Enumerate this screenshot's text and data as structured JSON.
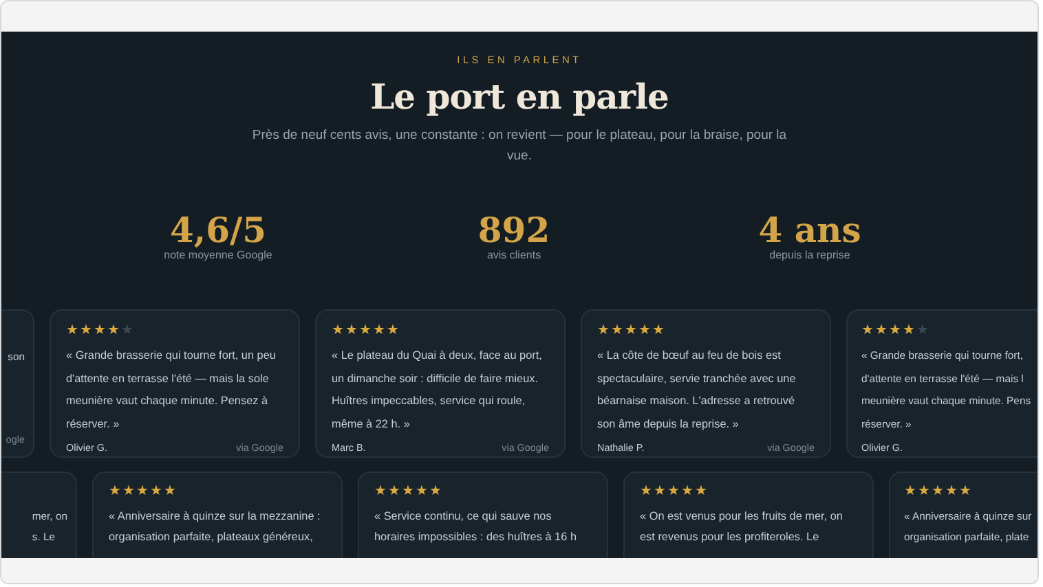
{
  "eyebrow": "ILS EN PARLENT",
  "title": "Le port en parle",
  "subtitle": "Près de neuf cents avis, une constante : on revient — pour le plateau, pour la braise, pour la vue.",
  "stats": [
    {
      "value": "4,6/5",
      "label": "note moyenne Google"
    },
    {
      "value": "892",
      "label": "avis clients"
    },
    {
      "value": "4 ans",
      "label": "depuis la reprise"
    }
  ],
  "review_rows": [
    {
      "cards": [
        {
          "kind": "partial-left",
          "lines": [
            "son"
          ],
          "source": "ogle"
        },
        {
          "kind": "full",
          "stars": 4,
          "text": "« Grande brasserie qui tourne fort, un peu d'attente en terrasse l'été — mais la sole meunière vaut chaque minute. Pensez à réserver. »",
          "author": "Olivier G.",
          "source": "via Google"
        },
        {
          "kind": "full",
          "stars": 5,
          "text": "« Le plateau du Quai à deux, face au port, un dimanche soir : difficile de faire mieux. Huîtres impeccables, service qui roule, même à 22 h. »",
          "author": "Marc B.",
          "source": "via Google"
        },
        {
          "kind": "full",
          "stars": 5,
          "text": "« La côte de bœuf au feu de bois est spectaculaire, servie tranchée avec une béarnaise maison. L'adresse a retrouvé son âme depuis la reprise. »",
          "author": "Nathalie P.",
          "source": "via Google"
        },
        {
          "kind": "partial-right",
          "stars": 4,
          "lines": [
            "« Grande brasserie qui tourne fort,",
            "d'attente en terrasse l'été — mais l",
            "meunière vaut chaque minute. Pens",
            "réserver. »"
          ],
          "author": "Olivier G."
        }
      ]
    },
    {
      "cards": [
        {
          "kind": "partial-left",
          "lines": [
            "mer, on",
            "s. Le"
          ]
        },
        {
          "kind": "full",
          "stars": 5,
          "text": "« Anniversaire à quinze sur la mezzanine : organisation parfaite, plateaux généreux,"
        },
        {
          "kind": "full",
          "stars": 5,
          "text": "« Service continu, ce qui sauve nos horaires impossibles : des huîtres à 16 h"
        },
        {
          "kind": "full",
          "stars": 5,
          "text": "« On est venus pour les fruits de mer, on est revenus pour les profiteroles. Le"
        },
        {
          "kind": "partial-right",
          "stars": 5,
          "lines": [
            "« Anniversaire à quinze sur",
            "organisation parfaite, plate"
          ]
        }
      ]
    }
  ]
}
